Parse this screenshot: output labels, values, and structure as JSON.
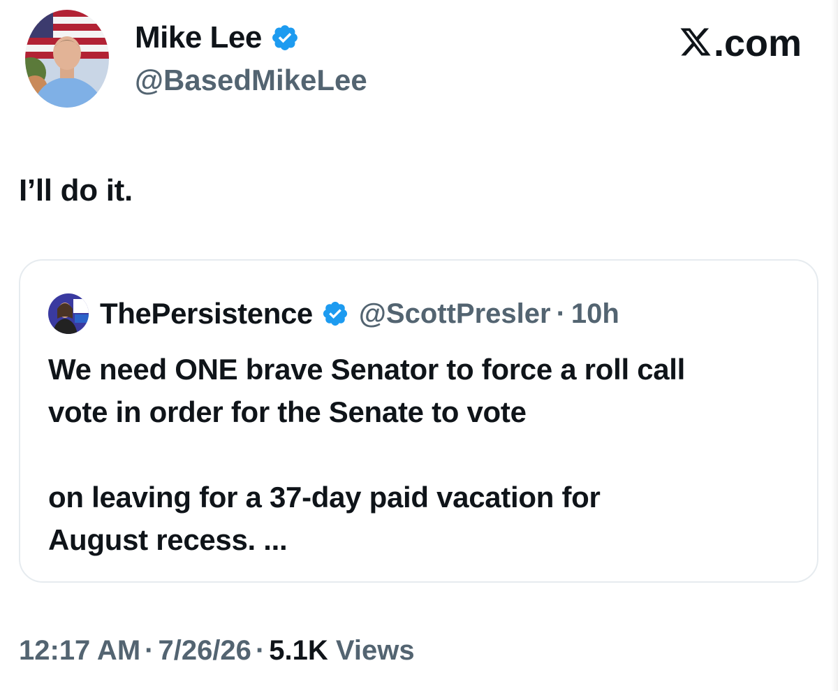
{
  "author": {
    "name": "Mike Lee",
    "handle": "@BasedMikeLee",
    "verified_icon": "verified-badge-icon",
    "verified_color": "#1d9bf0"
  },
  "brand": {
    "logo_letter": "X",
    "logo_suffix": ".com"
  },
  "tweet": {
    "text": "I’ll do it."
  },
  "quote": {
    "name": "ThePersistence",
    "handle": "@ScottPresler",
    "separator": "·",
    "time": "10h",
    "body_line1": "We need ONE brave Senator to force a roll call",
    "body_line2": "vote in order for the Senate to vote",
    "body_line3": "on leaving for a 37-day paid vacation for",
    "body_line4": "August recess. ..."
  },
  "meta": {
    "time": "12:17 AM",
    "date": "7/26/26",
    "separator": "·",
    "views_count": "5.1K",
    "views_label": "Views"
  },
  "colors": {
    "text_primary": "#0f1419",
    "text_secondary": "#536471",
    "border": "#e6ebef"
  }
}
